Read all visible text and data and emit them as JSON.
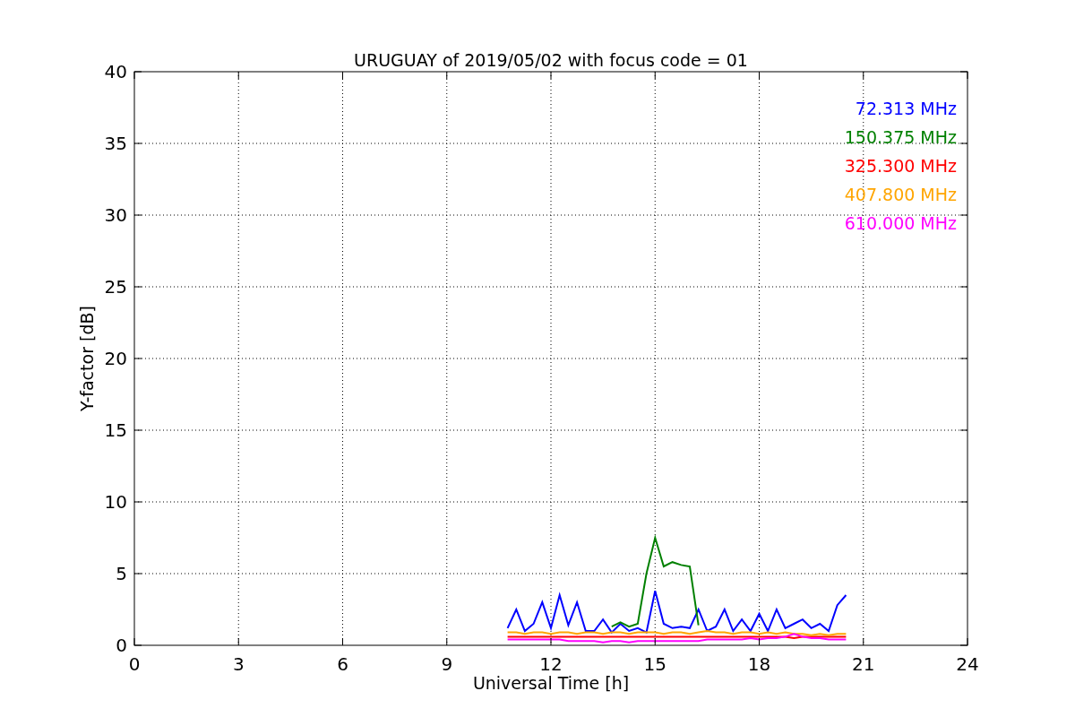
{
  "chart_data": {
    "type": "line",
    "title": "URUGUAY of 2019/05/02 with focus code = 01",
    "xlabel": "Universal Time [h]",
    "ylabel": "Y-factor [dB]",
    "x": [
      10.75,
      11.0,
      11.25,
      11.5,
      11.75,
      12.0,
      12.25,
      12.5,
      12.75,
      13.0,
      13.25,
      13.5,
      13.75,
      14.0,
      14.25,
      14.5,
      14.75,
      15.0,
      15.25,
      15.5,
      15.75,
      16.0,
      16.25,
      16.5,
      16.75,
      17.0,
      17.25,
      17.5,
      17.75,
      18.0,
      18.25,
      18.5,
      18.75,
      19.0,
      19.25,
      19.5,
      19.75,
      20.0,
      20.25,
      20.5
    ],
    "series": [
      {
        "name": "72.313 MHz",
        "color": "#0000ff",
        "values": [
          1.2,
          2.5,
          1.0,
          1.5,
          3.0,
          1.2,
          3.5,
          1.4,
          3.0,
          1.0,
          1.0,
          1.8,
          0.9,
          1.5,
          1.0,
          1.2,
          0.9,
          3.8,
          1.5,
          1.2,
          1.3,
          1.2,
          2.5,
          1.0,
          1.3,
          2.5,
          1.0,
          1.8,
          1.0,
          2.2,
          1.0,
          2.5,
          1.2,
          1.5,
          1.8,
          1.2,
          1.5,
          1.0,
          2.8,
          3.5
        ]
      },
      {
        "name": "150.375 MHz",
        "color": "#008000",
        "values": [
          null,
          null,
          null,
          null,
          null,
          null,
          null,
          null,
          null,
          null,
          null,
          null,
          1.3,
          1.6,
          1.3,
          1.5,
          5.0,
          7.5,
          5.5,
          5.8,
          5.6,
          5.5,
          1.4,
          null,
          null,
          null,
          null,
          null,
          null,
          null,
          null,
          null,
          null,
          null,
          null,
          null,
          null,
          null,
          null,
          null
        ]
      },
      {
        "name": "325.300 MHz",
        "color": "#ff0000",
        "values": [
          0.6,
          0.6,
          0.6,
          0.6,
          0.6,
          0.6,
          0.6,
          0.6,
          0.6,
          0.6,
          0.6,
          0.6,
          0.6,
          0.6,
          0.6,
          0.6,
          0.6,
          0.6,
          0.6,
          0.6,
          0.6,
          0.6,
          0.6,
          0.6,
          0.6,
          0.6,
          0.6,
          0.6,
          0.6,
          0.6,
          0.6,
          0.6,
          0.6,
          0.5,
          0.6,
          0.6,
          0.6,
          0.6,
          0.6,
          0.6
        ]
      },
      {
        "name": "407.800 MHz",
        "color": "#ffa500",
        "values": [
          0.9,
          0.9,
          0.8,
          0.9,
          0.9,
          0.8,
          0.9,
          0.9,
          0.8,
          0.9,
          0.9,
          0.8,
          0.9,
          0.9,
          0.8,
          0.9,
          0.9,
          0.9,
          0.8,
          0.9,
          0.9,
          0.8,
          0.9,
          1.0,
          0.9,
          0.9,
          0.8,
          0.9,
          0.9,
          0.8,
          0.9,
          0.8,
          0.9,
          0.8,
          0.8,
          0.7,
          0.8,
          0.7,
          0.8,
          0.8
        ]
      },
      {
        "name": "610.000 MHz",
        "color": "#ff00ff",
        "values": [
          0.4,
          0.4,
          0.4,
          0.4,
          0.4,
          0.4,
          0.4,
          0.3,
          0.3,
          0.3,
          0.3,
          0.2,
          0.3,
          0.3,
          0.2,
          0.3,
          0.3,
          0.3,
          0.3,
          0.3,
          0.3,
          0.3,
          0.3,
          0.4,
          0.4,
          0.4,
          0.4,
          0.4,
          0.5,
          0.4,
          0.5,
          0.5,
          0.6,
          0.8,
          0.6,
          0.5,
          0.5,
          0.4,
          0.4,
          0.4
        ]
      }
    ],
    "grid": true,
    "xlim": [
      0,
      24
    ],
    "ylim": [
      0,
      40
    ],
    "xticks": [
      0,
      3,
      6,
      9,
      12,
      15,
      18,
      21,
      24
    ],
    "yticks": [
      0,
      5,
      10,
      15,
      20,
      25,
      30,
      35,
      40
    ]
  }
}
